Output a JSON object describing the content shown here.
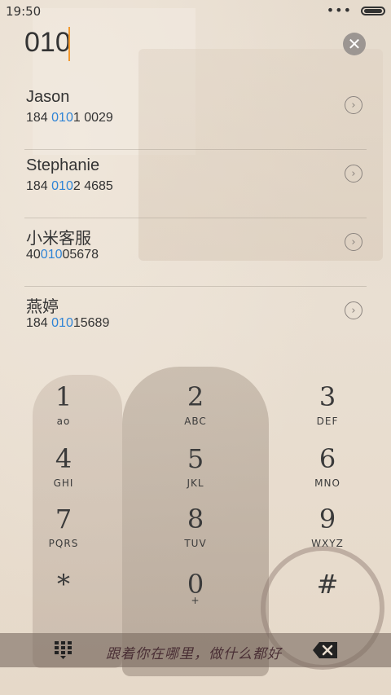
{
  "status_bar": {
    "time": "19:50",
    "dots": "•••"
  },
  "dialer": {
    "input_value": "010"
  },
  "contacts": [
    {
      "name": "Jason",
      "number_pre": "184 ",
      "number_match": "010",
      "number_post": "1 0029"
    },
    {
      "name": "Stephanie",
      "number_pre": "184 ",
      "number_match": "010",
      "number_post": "2 4685"
    },
    {
      "name": "小米客服",
      "number_pre": "40",
      "number_match": "010",
      "number_post": "05678"
    },
    {
      "name": "燕婷",
      "number_pre": "184 ",
      "number_match": "010",
      "number_post": "15689"
    }
  ],
  "keypad": [
    {
      "digit": "1",
      "letters": "ao"
    },
    {
      "digit": "2",
      "letters": "ABC"
    },
    {
      "digit": "3",
      "letters": "DEF"
    },
    {
      "digit": "4",
      "letters": "GHI"
    },
    {
      "digit": "5",
      "letters": "JKL"
    },
    {
      "digit": "6",
      "letters": "MNO"
    },
    {
      "digit": "7",
      "letters": "PQRS"
    },
    {
      "digit": "8",
      "letters": "TUV"
    },
    {
      "digit": "9",
      "letters": "WXYZ"
    },
    {
      "digit": "*",
      "letters": ""
    },
    {
      "digit": "0",
      "letters": "+"
    },
    {
      "digit": "#",
      "letters": ""
    }
  ],
  "bottom_bar": {
    "slogan": "跟着你在哪里，做什么都好"
  },
  "icons": {
    "clear": "clear-circle-icon",
    "chevron": "chevron-right-circle-icon",
    "keypad": "keypad-grid-icon",
    "backspace": "backspace-icon"
  },
  "colors": {
    "accent": "#2f84d6",
    "caret": "#f2992f"
  }
}
